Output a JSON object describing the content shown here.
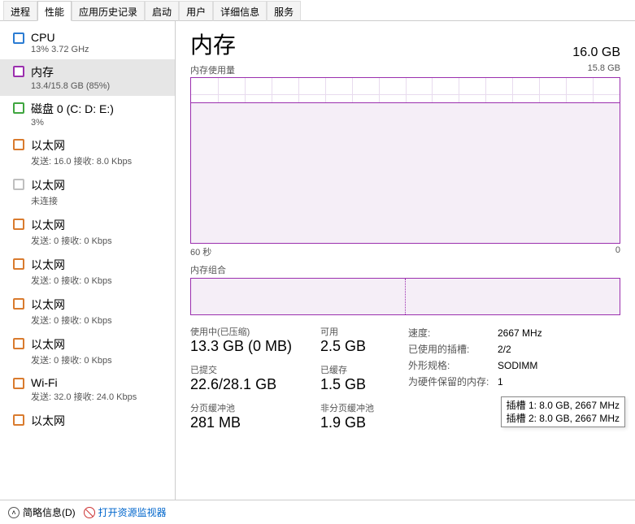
{
  "tabs": [
    "进程",
    "性能",
    "应用历史记录",
    "启动",
    "用户",
    "详细信息",
    "服务"
  ],
  "active_tab": 1,
  "sidebar": {
    "items": [
      {
        "title": "CPU",
        "sub": "13%  3.72 GHz",
        "ind": "ind-blue"
      },
      {
        "title": "内存",
        "sub": "13.4/15.8 GB (85%)",
        "ind": "ind-purple",
        "selected": true
      },
      {
        "title": "磁盘 0 (C: D: E:)",
        "sub": "3%",
        "ind": "ind-green"
      },
      {
        "title": "以太网",
        "sub": "发送: 16.0  接收: 8.0 Kbps",
        "ind": "ind-orange"
      },
      {
        "title": "以太网",
        "sub": "未连接",
        "ind": "ind-gray"
      },
      {
        "title": "以太网",
        "sub": "发送: 0  接收: 0 Kbps",
        "ind": "ind-orange"
      },
      {
        "title": "以太网",
        "sub": "发送: 0  接收: 0 Kbps",
        "ind": "ind-orange"
      },
      {
        "title": "以太网",
        "sub": "发送: 0  接收: 0 Kbps",
        "ind": "ind-orange"
      },
      {
        "title": "以太网",
        "sub": "发送: 0  接收: 0 Kbps",
        "ind": "ind-orange"
      },
      {
        "title": "Wi-Fi",
        "sub": "发送: 32.0  接收: 24.0 Kbps",
        "ind": "ind-orange"
      },
      {
        "title": "以太网",
        "sub": "",
        "ind": "ind-orange"
      }
    ]
  },
  "main": {
    "title": "内存",
    "capacity": "16.0 GB",
    "usage_label": "内存使用量",
    "usage_max": "15.8 GB",
    "x_left": "60 秒",
    "x_right": "0",
    "slots_label": "内存组合",
    "metrics": {
      "in_use_label": "使用中(已压缩)",
      "in_use": "13.3 GB (0 MB)",
      "avail_label": "可用",
      "avail": "2.5 GB",
      "committed_label": "已提交",
      "committed": "22.6/28.1 GB",
      "cached_label": "已缓存",
      "cached": "1.5 GB",
      "paged_label": "分页缓冲池",
      "paged": "281 MB",
      "nonpaged_label": "非分页缓冲池",
      "nonpaged": "1.9 GB"
    },
    "specs": {
      "speed_k": "速度:",
      "speed_v": "2667 MHz",
      "slots_k": "已使用的插槽:",
      "slots_v": "2/2",
      "form_k": "外形规格:",
      "form_v": "SODIMM",
      "hw_k": "为硬件保留的内存:",
      "hw_v": "1"
    }
  },
  "tooltip": {
    "line1": "插槽 1: 8.0 GB, 2667 MHz",
    "line2": "插槽 2: 8.0 GB, 2667 MHz"
  },
  "footer": {
    "brief": "简略信息(D)",
    "resmon": "打开资源监视器"
  },
  "chart_data": {
    "type": "area",
    "title": "内存使用量",
    "xlabel": "秒",
    "ylabel": "GB",
    "xlim": [
      60,
      0
    ],
    "ylim": [
      0,
      15.8
    ],
    "series": [
      {
        "name": "使用中",
        "values_approx_gb": 13.4,
        "note": "nearly flat line around 13.4 GB across 60s window"
      }
    ]
  }
}
